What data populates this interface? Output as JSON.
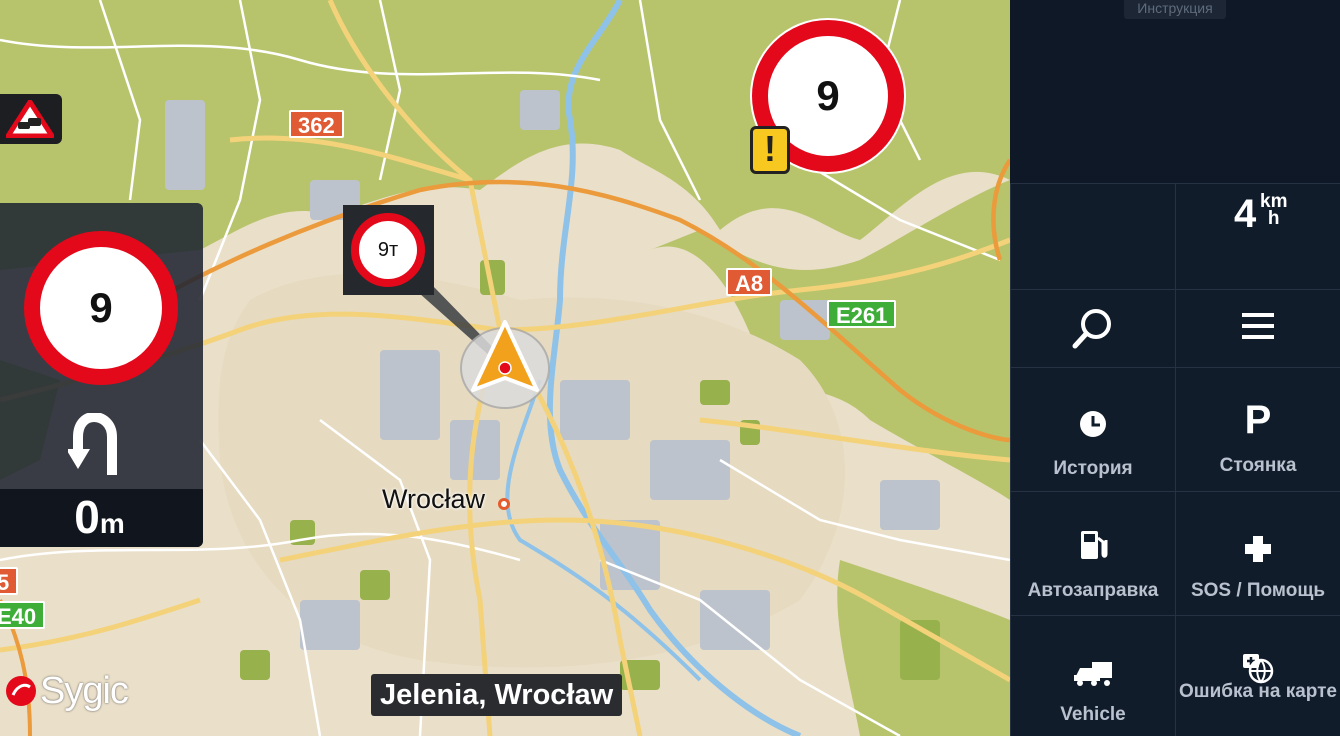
{
  "map": {
    "road_badges": [
      "362",
      "A8",
      "E261",
      "5",
      "E40"
    ],
    "city": "Wrocław",
    "street": "Jelenia, Wrocław",
    "callout_limit": "9т",
    "big_limit": "9",
    "warning": "!",
    "logo": "Sygic"
  },
  "instruction": {
    "speed_limit": "9",
    "distance": "0",
    "distance_unit": "m"
  },
  "panel": {
    "tab_label": "Инструкция",
    "speed_value": "4",
    "speed_unit_top": "km",
    "speed_unit_bottom": "h",
    "buttons": [
      {
        "label": "История",
        "icon": "history-icon"
      },
      {
        "label": "Стоянка",
        "icon": "parking-icon"
      },
      {
        "label": "Автозаправка",
        "icon": "fuel-icon"
      },
      {
        "label": "SOS / Помощь",
        "icon": "sos-icon"
      },
      {
        "label": "Vehicle",
        "icon": "vehicle-icon"
      },
      {
        "label": "Ошибка на карте",
        "icon": "map-error-icon"
      }
    ]
  },
  "colors": {
    "limit_red": "#e3091b",
    "road_red": "#e05a33",
    "road_green": "#3fae39",
    "map_land": "#eadfc9",
    "panel_bg": "#0e1826"
  }
}
